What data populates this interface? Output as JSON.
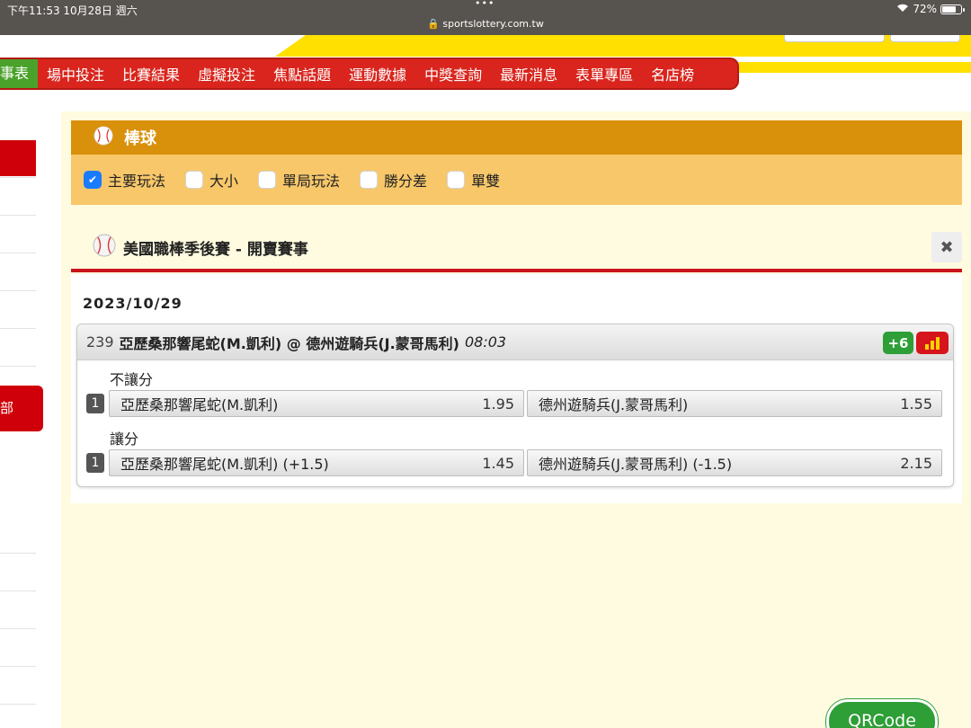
{
  "status_bar": {
    "time": "下午11:53 10月28日 週六",
    "dots": "•••",
    "url": "sportslottery.com.tw",
    "battery": "72%"
  },
  "nav": {
    "items": [
      "事表",
      "場中投注",
      "比賽結果",
      "虛擬投注",
      "焦點話題",
      "運動數據",
      "中獎查詢",
      "最新消息",
      "表單專區",
      "名店榜"
    ]
  },
  "sidebar": {
    "label": "部"
  },
  "sport": {
    "title": "棒球",
    "filters": [
      {
        "label": "主要玩法",
        "checked": true
      },
      {
        "label": "大小",
        "checked": false
      },
      {
        "label": "單局玩法",
        "checked": false
      },
      {
        "label": "勝分差",
        "checked": false
      },
      {
        "label": "單雙",
        "checked": false
      }
    ]
  },
  "league": {
    "title": "美國職棒季後賽 - 開賣賽事",
    "close": "✖"
  },
  "date": "2023/10/29",
  "match": {
    "number": "239",
    "teams": "亞歷桑那響尾蛇(M.凱利) @ 德州遊騎兵(J.蒙哥馬利)",
    "time": "08:03",
    "more_badge": "+6",
    "markets": [
      {
        "label": "不讓分",
        "index": "1",
        "home": {
          "name": "亞歷桑那響尾蛇(M.凱利)",
          "odds": "1.95"
        },
        "away": {
          "name": "德州遊騎兵(J.蒙哥馬利)",
          "odds": "1.55"
        }
      },
      {
        "label": "讓分",
        "index": "1",
        "home": {
          "name": "亞歷桑那響尾蛇(M.凱利) (+1.5)",
          "odds": "1.45"
        },
        "away": {
          "name": "德州遊騎兵(J.蒙哥馬利) (-1.5)",
          "odds": "2.15"
        }
      }
    ]
  },
  "qrcode": "QRCode",
  "icons": {
    "league": "baseball-icon",
    "stats": "bar-chart-icon",
    "wifi": "wifi-icon"
  },
  "colors": {
    "nav_red": "#d9251d",
    "sport_header": "#d9900a",
    "filter_bg": "#f7c76a",
    "content_bg": "#fffbe0",
    "badge_green": "#2e9e36"
  }
}
